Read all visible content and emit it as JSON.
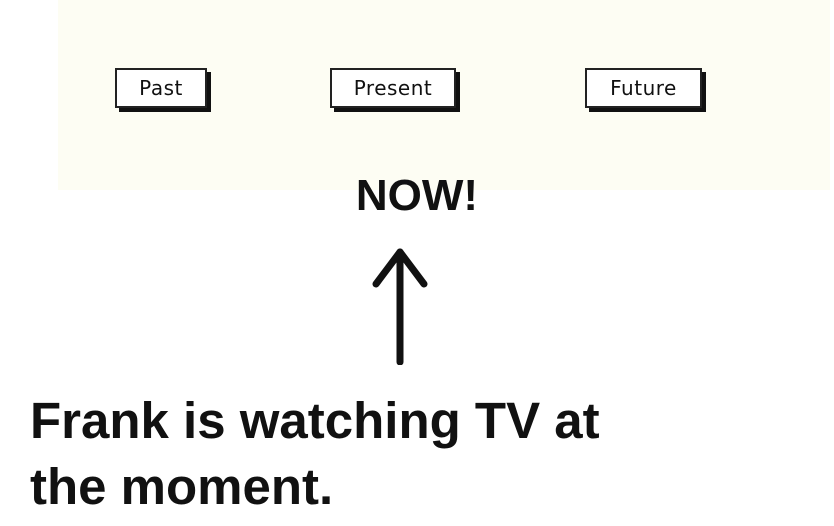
{
  "timeline": {
    "labels": {
      "past": "Past",
      "present": "Present",
      "future": "Future"
    }
  },
  "pointer": {
    "label": "NOW!",
    "icon": "up-arrow-icon"
  },
  "example": {
    "line1": "Frank is watching TV at",
    "line2": "the moment."
  },
  "colors": {
    "ink": "#111111",
    "panel": "#fdfdf3",
    "background": "#ffffff"
  }
}
